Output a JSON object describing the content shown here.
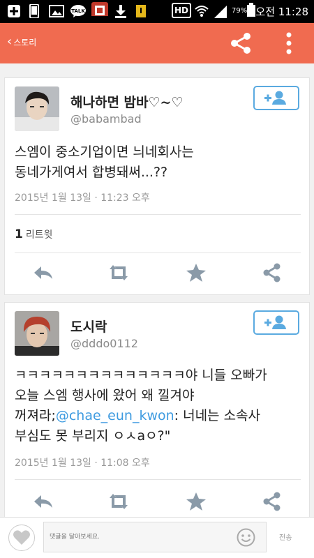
{
  "status_bar": {
    "hd": "HD",
    "battery": "79%",
    "time": "오전 11:28"
  },
  "header": {
    "back_label": "스토리",
    "share_icon": "share-icon",
    "more_icon": "more-vert-icon",
    "color": "#f06b50"
  },
  "tweets": [
    {
      "name": "해나하면 밤바♡~♡",
      "handle": "@babambad",
      "text_lines": [
        "스엠이 중소기업이면 늬네회사는",
        "동네가게여서 합병돼써...??"
      ],
      "date": "2015년 1월 13일 · 11:23 오후",
      "retweet_count": "1",
      "retweet_label": "리트윗"
    },
    {
      "name": "도시락",
      "handle": "@dddo0112",
      "text_line1": "ㅋㅋㅋㅋㅋㅋㅋㅋㅋㅋㅋㅋㅋㅋ야 니들 오빠가",
      "text_line2": "오늘 스엠 행사에 왔어 왜 낄겨야",
      "text_line3_pre": "꺼져라;",
      "mention": "@chae_eun_kwon",
      "text_line3_post": ": 너네는 소속사",
      "text_line4": "부심도 못 부리지 ㅇㅅaㅇ?\"",
      "date": "2015년 1월 13일 · 11:08 오후"
    }
  ],
  "bottom": {
    "comment_placeholder": "댓글을 달아보세요.",
    "send_label": "전송"
  },
  "colors": {
    "accent": "#f06b50",
    "link": "#3e9be0",
    "follow_border": "#5aaae0",
    "action_icon": "#8a9aa8"
  }
}
